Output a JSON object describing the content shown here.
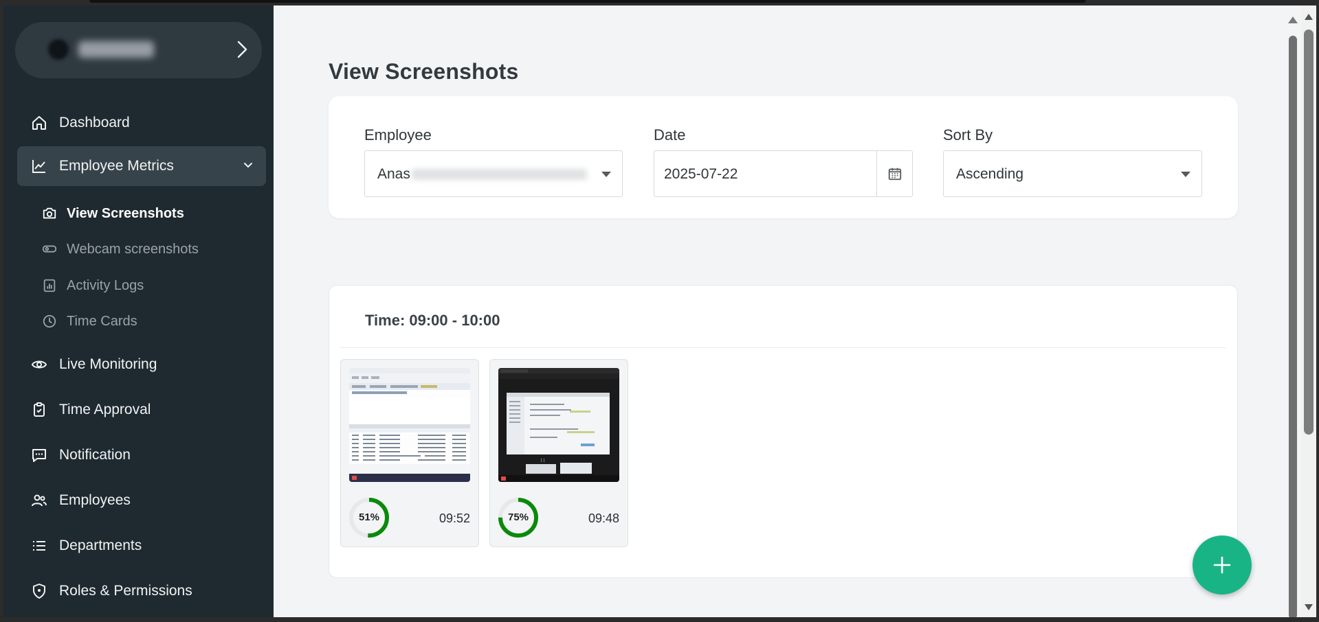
{
  "colors": {
    "sidebar_bg": "#1f2a30",
    "accent": "#19b486",
    "ring": "#0a8a0a",
    "page_bg": "#f3f4f6"
  },
  "sidebar": {
    "items": [
      {
        "label": "Dashboard",
        "icon": "home-icon"
      },
      {
        "label": "Employee Metrics",
        "icon": "chart-line-icon"
      },
      {
        "label": "Live Monitoring",
        "icon": "eye-icon"
      },
      {
        "label": "Time Approval",
        "icon": "clipboard-icon"
      },
      {
        "label": "Notification",
        "icon": "message-icon"
      },
      {
        "label": "Employees",
        "icon": "users-icon"
      },
      {
        "label": "Departments",
        "icon": "list-icon"
      },
      {
        "label": "Roles & Permissions",
        "icon": "shield-icon"
      }
    ],
    "sub_items": [
      {
        "label": "View Screenshots",
        "icon": "camera-icon"
      },
      {
        "label": "Webcam screenshots",
        "icon": "webcam-icon"
      },
      {
        "label": "Activity Logs",
        "icon": "bar-chart-icon"
      },
      {
        "label": "Time Cards",
        "icon": "clock-icon"
      }
    ]
  },
  "page": {
    "title": "View Screenshots"
  },
  "filters": {
    "employee_label": "Employee",
    "employee_value": "Anas",
    "date_label": "Date",
    "date_value": "2025-07-22",
    "sort_label": "Sort By",
    "sort_value": "Ascending"
  },
  "group": {
    "title": "Time: 09:00 - 10:00",
    "screenshots": [
      {
        "activity": "51%",
        "activity_fraction": 0.51,
        "time": "09:52"
      },
      {
        "activity": "75%",
        "activity_fraction": 0.75,
        "time": "09:48"
      }
    ]
  },
  "fab": {
    "icon": "plus-icon"
  }
}
